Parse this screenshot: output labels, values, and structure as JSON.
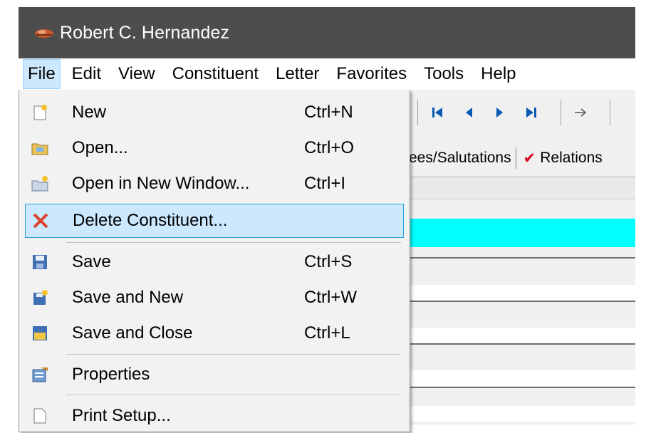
{
  "window": {
    "title": "Robert C. Hernandez",
    "icon": "app-logo-icon"
  },
  "menubar": [
    "File",
    "Edit",
    "View",
    "Constituent",
    "Letter",
    "Favorites",
    "Tools",
    "Help"
  ],
  "file_menu": [
    {
      "label": "New",
      "shortcut": "Ctrl+N",
      "icon": "new-document-icon"
    },
    {
      "label": "Open...",
      "shortcut": "Ctrl+O",
      "icon": "open-folder-icon"
    },
    {
      "label": "Open in New Window...",
      "shortcut": "Ctrl+I",
      "icon": "open-new-window-icon"
    },
    {
      "label": "Delete Constituent...",
      "shortcut": "",
      "icon": "delete-icon",
      "highlighted": true
    },
    {
      "label": "Save",
      "shortcut": "Ctrl+S",
      "icon": "save-icon"
    },
    {
      "label": "Save and New",
      "shortcut": "Ctrl+W",
      "icon": "save-and-new-icon"
    },
    {
      "label": "Save and Close",
      "shortcut": "Ctrl+L",
      "icon": "save-and-close-icon"
    },
    {
      "label": "Properties",
      "shortcut": "",
      "icon": "properties-icon"
    },
    {
      "label": "Print Setup...",
      "shortcut": "",
      "icon": "print-setup-icon"
    }
  ],
  "toolbar": {
    "icons": [
      "first-record-icon",
      "previous-record-icon",
      "next-record-icon",
      "last-record-icon",
      "go-to-arrow-icon"
    ]
  },
  "tabs": {
    "partial_tab": "ees/Salutations",
    "relations_tab": "Relations"
  },
  "colors": {
    "titlebar": "#4d4d4d",
    "highlight": "#cce8ff",
    "highlight_border": "#26a0da",
    "grid_selected": "#00ffff",
    "nav_blue": "#0a5ab4"
  }
}
